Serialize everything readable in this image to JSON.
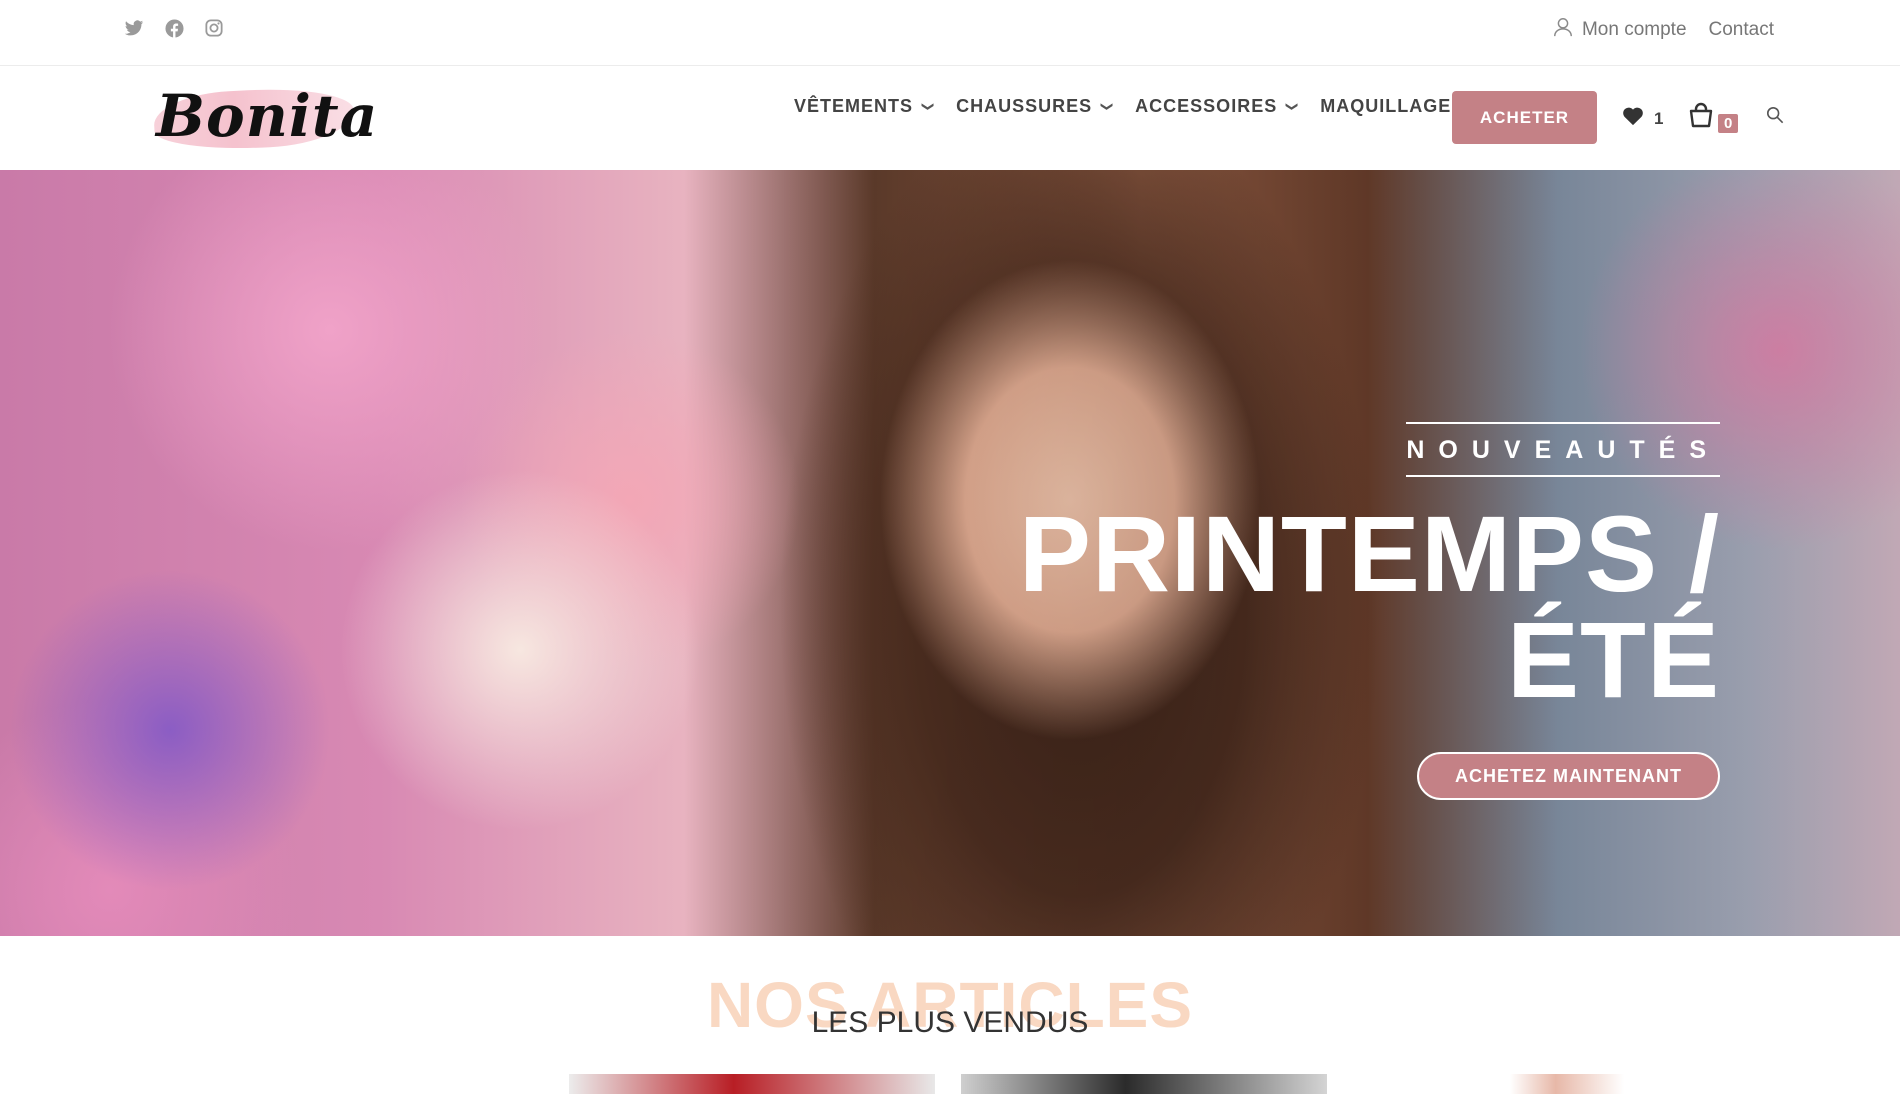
{
  "topbar": {
    "social": [
      "twitter-icon",
      "facebook-icon",
      "instagram-icon"
    ],
    "account_label": "Mon compte",
    "contact_label": "Contact"
  },
  "header": {
    "logo_text": "Bonita",
    "nav": [
      {
        "label": "VÊTEMENTS"
      },
      {
        "label": "CHAUSSURES"
      },
      {
        "label": "ACCESSOIRES"
      },
      {
        "label": "MAQUILLAGE"
      }
    ],
    "buy_button": "ACHETER",
    "wishlist_count": "1",
    "cart_count": "0"
  },
  "hero": {
    "kicker": "NOUVEAUTÉS",
    "headline_line1": "PRINTEMPS /",
    "headline_line2": "ÉTÉ",
    "cta": "ACHETEZ MAINTENANT"
  },
  "articles": {
    "big_title": "NOS ARTICLES",
    "subtitle": "LES PLUS VENDUS"
  },
  "colors": {
    "accent": "#c48186",
    "soft_peach": "#f9d8c2"
  }
}
